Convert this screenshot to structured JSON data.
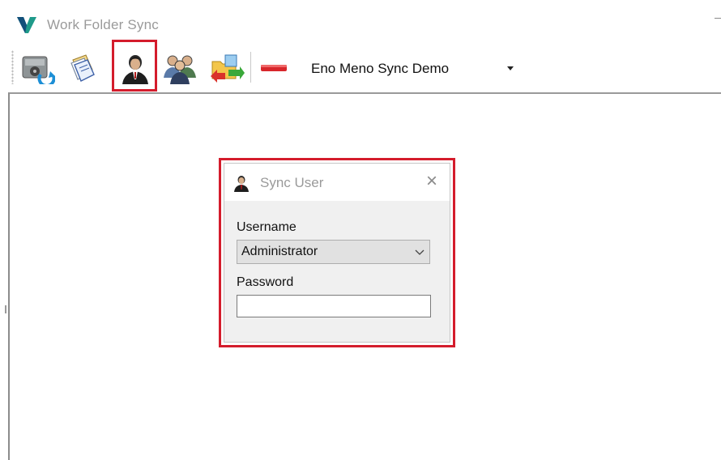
{
  "window": {
    "title": "Work Folder Sync",
    "logo_icon": "app-logo-icon"
  },
  "toolbar": {
    "buttons": [
      {
        "name": "sync-drive-button",
        "icon": "drive-sync-icon"
      },
      {
        "name": "documents-button",
        "icon": "documents-icon"
      },
      {
        "name": "sync-user-button",
        "icon": "user-icon",
        "highlighted": true
      },
      {
        "name": "user-group-button",
        "icon": "user-group-icon"
      },
      {
        "name": "transfer-button",
        "icon": "folder-transfer-icon"
      },
      {
        "name": "remove-button",
        "icon": "remove-icon"
      }
    ],
    "profile_select": {
      "value": "Eno Meno Sync Demo"
    }
  },
  "dialog": {
    "title": "Sync User",
    "icon": "user-icon",
    "username_label": "Username",
    "username_value": "Administrator",
    "password_label": "Password",
    "password_value": ""
  },
  "colors": {
    "highlight": "#d41c2c",
    "dialog_bg": "#f0f0f0",
    "title_text": "#9a9a9a"
  }
}
